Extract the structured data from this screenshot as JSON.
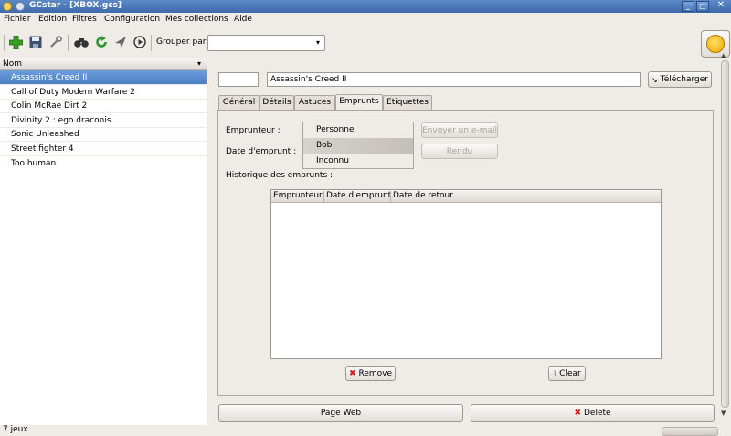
{
  "window": {
    "title": "GCstar - [XBOX.gcs]",
    "controls": [
      "_",
      "□",
      "✕"
    ]
  },
  "menu": [
    "Fichier",
    "Edition",
    "Filtres",
    "Configuration",
    "Mes collections",
    "Aide"
  ],
  "toolbar": {
    "group_label": "Grouper par",
    "group_value": ""
  },
  "list": {
    "header": "Nom",
    "items": [
      "Assassin's Creed II",
      "Call of Duty Modern Warfare 2",
      "Colin McRae Dirt 2",
      "Divinity 2 : ego draconis",
      "Sonic Unleashed",
      "Street fighter 4",
      "Too human"
    ],
    "selected_index": 0
  },
  "detail": {
    "id_value": "",
    "title_value": "Assassin's Creed II",
    "download_label": "Télécharger",
    "tabs": [
      "Général",
      "Détails",
      "Astuces",
      "Emprunts",
      "Etiquettes"
    ],
    "active_tab": "Emprunts"
  },
  "loans": {
    "borrower_label": "Emprunteur :",
    "loan_date_label": "Date d'emprunt :",
    "borrowers": [
      "Personne",
      "Bob",
      "Inconnu"
    ],
    "selected_borrower": "Bob",
    "email_button": "Envoyer un e-mail",
    "returned_button": "Rendu",
    "history_label": "Historique des emprunts :",
    "history_columns": [
      "Emprunteur",
      "Date d'emprunt",
      "Date de retour"
    ],
    "history_rows": [],
    "remove_button": "Remove",
    "clear_button": "Clear"
  },
  "bottom": {
    "web_button": "Page Web",
    "delete_button": "Delete"
  },
  "status": {
    "text": "7 jeux"
  }
}
